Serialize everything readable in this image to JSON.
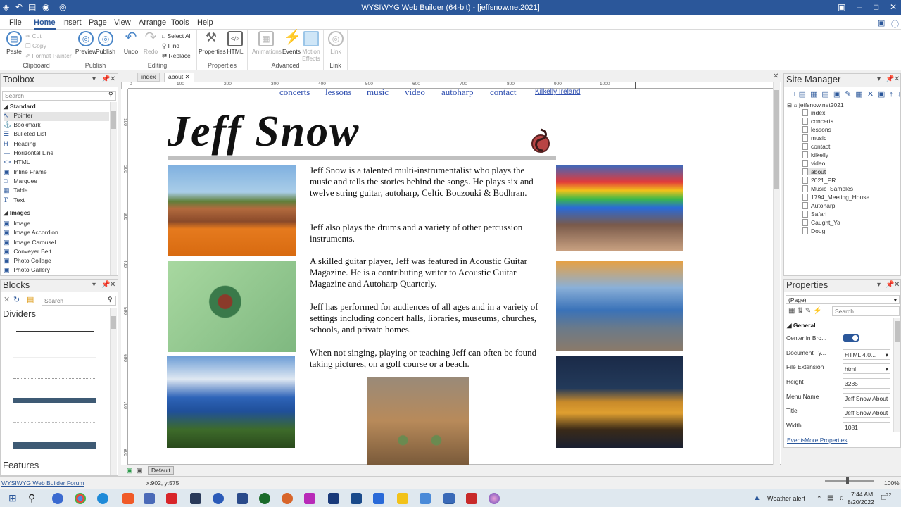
{
  "window": {
    "title": "WYSIWYG Web Builder (64-bit) - [jeffsnow.net2021]"
  },
  "menu": {
    "tabs": [
      "File",
      "Home",
      "Insert",
      "Page",
      "View",
      "Arrange",
      "Tools",
      "Help"
    ],
    "active": "Home"
  },
  "ribbon": {
    "clipboard": {
      "paste": "Paste",
      "cut": "Cut",
      "copy": "Copy",
      "format_painter": "Format Painter",
      "group": "Clipboard"
    },
    "publish": {
      "preview": "Preview",
      "publish": "Publish",
      "group": "Publish"
    },
    "editing": {
      "undo": "Undo",
      "redo": "Redo",
      "select_all": "Select All",
      "find": "Find",
      "replace": "Replace",
      "group": "Editing"
    },
    "properties": {
      "properties": "Properties",
      "html": "HTML",
      "group": "Properties"
    },
    "advanced": {
      "animations": "Animations",
      "events": "Events",
      "motion_effects": "Motion Effects",
      "group": "Advanced"
    },
    "link": {
      "link": "Link",
      "group": "Link"
    }
  },
  "toolbox": {
    "title": "Toolbox",
    "search_placeholder": "Search",
    "standard_label": "Standard",
    "standard": [
      "Pointer",
      "Bookmark",
      "Bulleted List",
      "Heading",
      "Horizontal Line",
      "HTML",
      "Inline Frame",
      "Marquee",
      "Table",
      "Text"
    ],
    "images_label": "Images",
    "images": [
      "Image",
      "Image Accordion",
      "Image Carousel",
      "Conveyer Belt",
      "Photo Collage",
      "Photo Gallery"
    ]
  },
  "blocks": {
    "title": "Blocks",
    "search_placeholder": "Search",
    "dividers_label": "Dividers",
    "features_label": "Features"
  },
  "doc_tabs": [
    "index",
    "about"
  ],
  "ruler_ticks": [
    "0",
    "100",
    "200",
    "300",
    "400",
    "500",
    "600",
    "700",
    "800",
    "900",
    "1000"
  ],
  "ruler_v_ticks": [
    "100",
    "200",
    "300",
    "400",
    "500",
    "600",
    "700",
    "800"
  ],
  "page": {
    "nav": [
      "concerts",
      "lessons",
      "music",
      "video",
      "autoharp",
      "contact",
      "Kilkelly Ireland"
    ],
    "heading": "Jeff Snow",
    "paragraphs": [
      "Jeff Snow is a talented multi-instrumentalist who plays the music and tells the stories behind the songs. He plays six and twelve string guitar, autoharp, Celtic Bouzouki & Bodhran.",
      "Jeff also plays the drums and a variety of other percussion instruments.",
      "A skilled guitar player, Jeff was featured in Acoustic Guitar Magazine. He is a contributing writer to Acoustic Guitar Magazine and Autoharp Quarterly.",
      "Jeff has performed for audiences of all ages and in a variety of settings including concert halls, libraries, museums, churches, schools, and private homes.",
      "When not singing, playing or teaching Jeff can often be found taking pictures, on a golf course or a beach."
    ]
  },
  "site_manager": {
    "title": "Site Manager",
    "root": "jeffsnow.net2021",
    "pages": [
      "index",
      "concerts",
      "lessons",
      "music",
      "contact",
      "kilkelly",
      "video",
      "about",
      "2021_PR",
      "Music_Samples",
      "1794_Meeting_House",
      "Autoharp",
      "Safari",
      "Caught_Ya",
      "Doug"
    ],
    "selected": "about"
  },
  "properties": {
    "title": "Properties",
    "object": "(Page)",
    "search_placeholder": "Search",
    "group": "General",
    "rows": [
      {
        "label": "Center in Bro...",
        "value": ""
      },
      {
        "label": "Document Ty...",
        "value": "HTML 4.0..."
      },
      {
        "label": "File Extension",
        "value": "html"
      },
      {
        "label": "Height",
        "value": "3285"
      },
      {
        "label": "Menu Name",
        "value": "Jeff Snow About"
      },
      {
        "label": "Title",
        "value": "Jeff Snow About"
      },
      {
        "label": "Width",
        "value": "1081"
      }
    ],
    "links": [
      "Events",
      "More Properties"
    ]
  },
  "status": {
    "link": "WYSIWYG Web Builder Forum",
    "coords": "x:902, y:575",
    "zoom": "100%",
    "layout": "Default"
  },
  "taskbar": {
    "weather": "Weather alert",
    "time": "7:44 AM",
    "date": "8/20/2022",
    "notifications": "22"
  },
  "colors": {
    "accent": "#2b579a",
    "link": "#3050b0"
  }
}
